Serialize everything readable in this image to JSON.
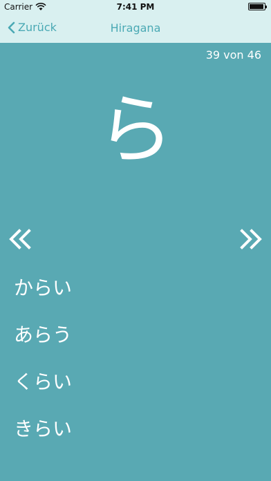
{
  "status": {
    "carrier": "Carrier",
    "time": "7:41 PM"
  },
  "nav": {
    "back_label": "Zurück",
    "title": "Hiragana"
  },
  "counter": "39 von 46",
  "character": "ら",
  "options": [
    "からい",
    "あらう",
    "くらい",
    "きらい"
  ],
  "colors": {
    "background": "#59a9b3",
    "nav_background": "#d9f0f0",
    "accent": "#4aa9b4",
    "text": "#ffffff"
  },
  "icons": {
    "back": "chevron-left-icon",
    "prev": "double-chevron-left-icon",
    "next": "double-chevron-right-icon",
    "wifi": "wifi-icon",
    "battery": "battery-icon"
  }
}
